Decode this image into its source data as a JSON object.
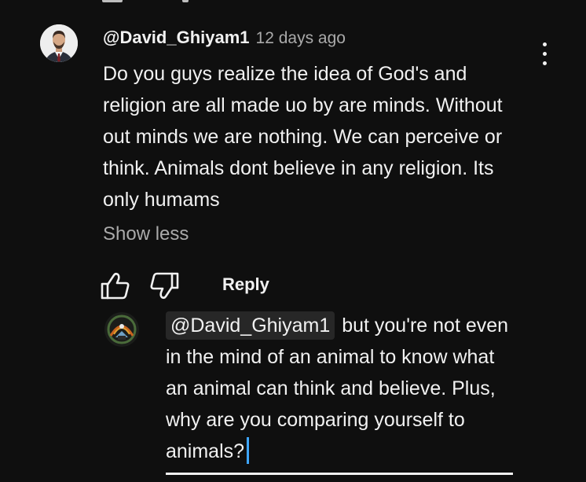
{
  "comment": {
    "author": "@David_Ghiyam1",
    "timestamp": "12 days ago",
    "text": "Do you guys realize the idea of God's and religion are all made uo by are minds. Without out minds we are nothing. We can perceive or think. Animals dont believe in any religion. Its only humams",
    "show_less_label": "Show less",
    "reply_label": "Reply"
  },
  "reply_draft": {
    "mention": "@David_Ghiyam1",
    "text": " but you're not even in the mind of an animal to know what an animal can think and believe. Plus, why are you comparing yourself to animals?"
  },
  "icons": {
    "more": "more-vert-icon",
    "like": "thumb-up-icon",
    "dislike": "thumb-down-icon"
  },
  "colors": {
    "background": "#0f0f0f",
    "text": "#f1f1f1",
    "secondary_text": "#aaaaaa",
    "caret": "#3ea6ff",
    "mention_chip": "#272727"
  }
}
